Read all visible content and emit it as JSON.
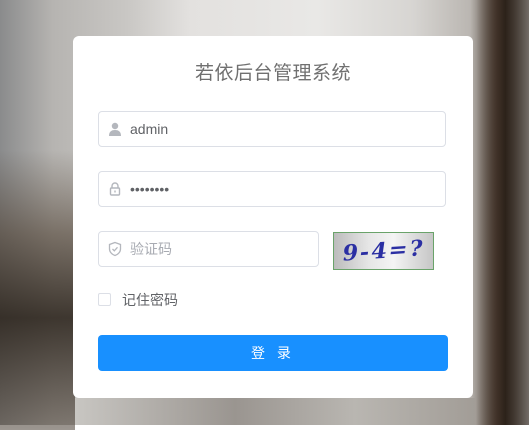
{
  "app": {
    "title": "若依后台管理系统"
  },
  "form": {
    "username": {
      "value": "admin",
      "icon": "user-icon"
    },
    "password": {
      "value": "••••••••",
      "icon": "lock-icon"
    },
    "code": {
      "placeholder": "验证码",
      "value": "",
      "icon": "shield-icon"
    },
    "captcha": {
      "text": "9-4=?"
    },
    "remember": {
      "label": "记住密码",
      "checked": false
    },
    "login_button": {
      "label": "登 录"
    }
  },
  "colors": {
    "primary": "#1890ff",
    "border": "#dcdfe6",
    "text": "#606266",
    "placeholder": "#a8abb2",
    "captcha_text": "#2b2fa3"
  }
}
